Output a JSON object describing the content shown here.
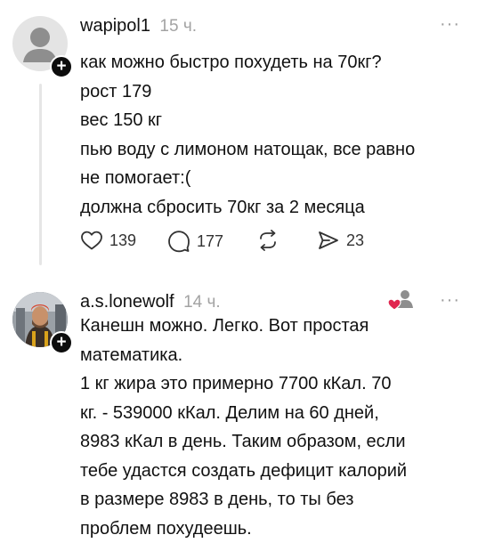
{
  "posts": [
    {
      "username": "wapipol1",
      "time": "15 ч.",
      "lines": [
        "как можно быстро похудеть на 70кг?",
        "рост 179",
        "вес 150 кг",
        "пью воду с лимоном натощак, все равно",
        "не помогает:(",
        "должна сбросить 70кг за 2 месяца"
      ],
      "likes": "139",
      "replies": "177",
      "shares": "23",
      "more_label": "···"
    },
    {
      "username": "a.s.lonewolf",
      "time": "14 ч.",
      "lines": [
        "Канешн можно. Легко. Вот простая",
        "математика.",
        "1 кг жира это примерно 7700 кКал. 70",
        "кг. - 539000 кКал. Делим на 60 дней,",
        "8983 кКал в день. Таким образом, если",
        "тебе удастся создать дефицит калорий",
        "в размере 8983  в день, то ты без",
        "проблем похудеешь."
      ],
      "more_label": "···"
    }
  ],
  "badge_plus": "+",
  "colors": {
    "text": "#111111",
    "muted": "#a3a3a3",
    "heart": "#e0264f"
  }
}
